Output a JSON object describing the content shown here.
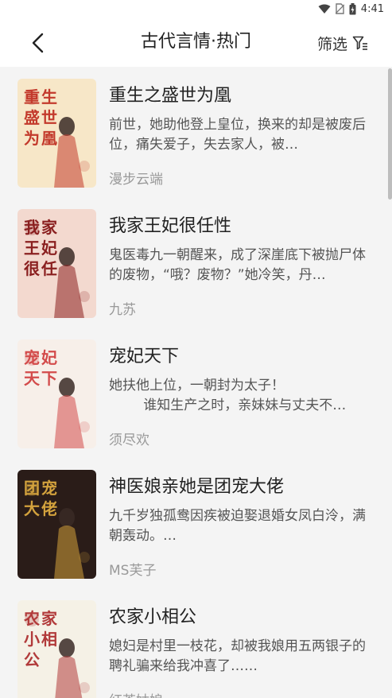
{
  "status": {
    "time": "4:41"
  },
  "header": {
    "title": "古代言情·热门",
    "filter_label": "筛选"
  },
  "books": [
    {
      "title": "重生之盛世为凰",
      "desc": "前世，她助他登上皇位，换来的却是被废后位，痛失爱子，失去家人，被…",
      "author": "漫步云端",
      "cover_text": "重生盛世为凰",
      "cover_colors": [
        "#f7e7c8",
        "#c33a2c"
      ]
    },
    {
      "title": "我家王妃很任性",
      "desc": "鬼医毒九一朝醒来，成了深崖底下被抛尸体的废物，“哦？废物？”她冷笑，丹…",
      "author": "九苏",
      "cover_text": "我家王妃很任性",
      "cover_colors": [
        "#f3d9cf",
        "#8a1f1f"
      ]
    },
    {
      "title": "宠妃天下",
      "desc": "她扶他上位，一朝封为太子！\n        谁知生产之时，亲妹妹与丈夫不…",
      "author": "须尽欢",
      "cover_text": "宠妃天下",
      "cover_colors": [
        "#f7efe9",
        "#d34b4b"
      ]
    },
    {
      "title": "神医娘亲她是团宠大佬",
      "desc": "九千岁独孤鸯因疾被迫娶退婚女凤白泠，满朝轰动。…",
      "author": "MS芙子",
      "cover_text": "团宠大佬",
      "cover_colors": [
        "#2a1c18",
        "#d3a23d"
      ]
    },
    {
      "title": "农家小相公",
      "desc": "媳妇是村里一枝花，却被我娘用五两银子的聘礼骗来给我冲喜了……",
      "author": "红茶姑娘",
      "cover_text": "农家小相公",
      "cover_colors": [
        "#f5f1e6",
        "#b13a3a"
      ]
    }
  ]
}
